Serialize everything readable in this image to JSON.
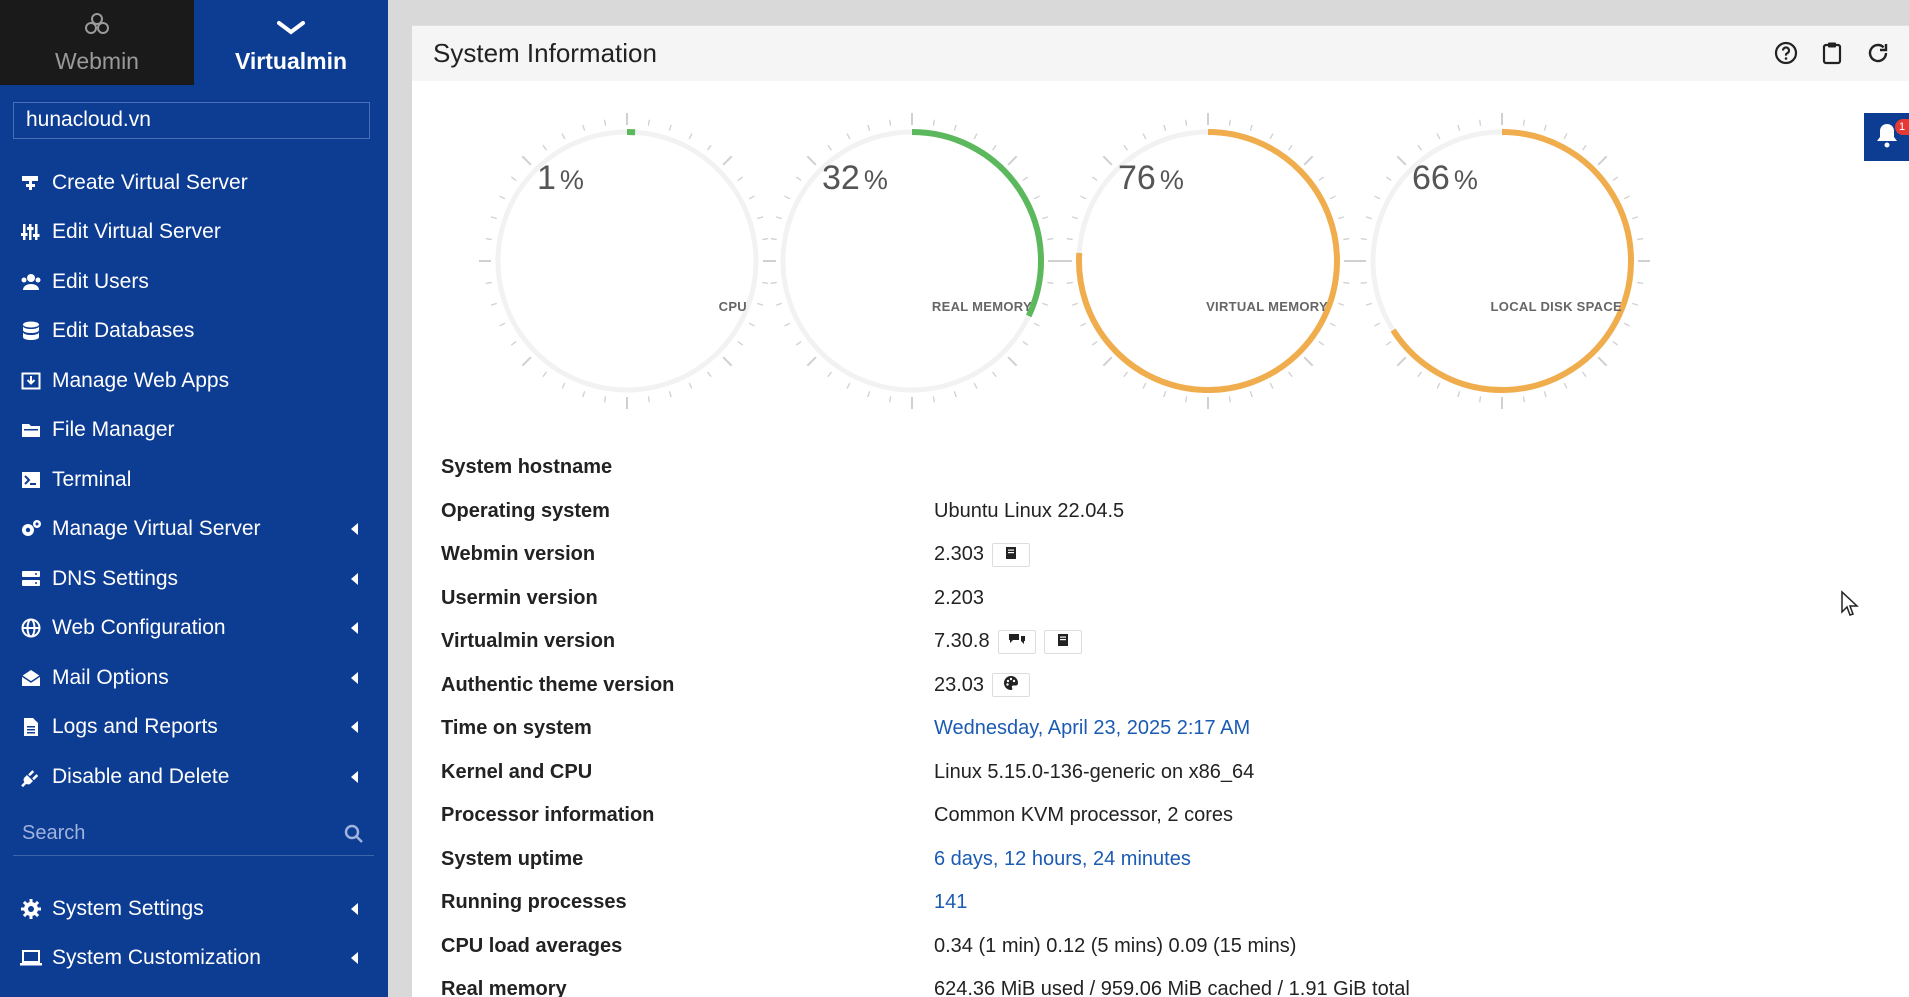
{
  "brand": {
    "webmin_label": "Webmin",
    "virtualmin_label": "Virtualmin"
  },
  "domain": {
    "value": "hunacloud.vn"
  },
  "menu": [
    {
      "label": "Create Virtual Server",
      "icon": "add-server-icon",
      "caret": false
    },
    {
      "label": "Edit Virtual Server",
      "icon": "sliders-icon",
      "caret": false
    },
    {
      "label": "Edit Users",
      "icon": "users-icon",
      "caret": false
    },
    {
      "label": "Edit Databases",
      "icon": "database-icon",
      "caret": false
    },
    {
      "label": "Manage Web Apps",
      "icon": "download-icon",
      "caret": false
    },
    {
      "label": "File Manager",
      "icon": "folder-icon",
      "caret": false
    },
    {
      "label": "Terminal",
      "icon": "terminal-icon",
      "caret": false
    },
    {
      "label": "Manage Virtual Server",
      "icon": "gears-icon",
      "caret": true
    },
    {
      "label": "DNS Settings",
      "icon": "server-icon",
      "caret": true
    },
    {
      "label": "Web Configuration",
      "icon": "globe-icon",
      "caret": true
    },
    {
      "label": "Mail Options",
      "icon": "envelope-open-icon",
      "caret": true
    },
    {
      "label": "Logs and Reports",
      "icon": "file-text-icon",
      "caret": true
    },
    {
      "label": "Disable and Delete",
      "icon": "plug-icon",
      "caret": true
    }
  ],
  "search": {
    "placeholder": "Search"
  },
  "menu2": [
    {
      "label": "System Settings",
      "icon": "gear-icon",
      "caret": true
    },
    {
      "label": "System Customization",
      "icon": "laptop-icon",
      "caret": true
    }
  ],
  "panel": {
    "title": "System Information",
    "header_icons": [
      "help-icon",
      "clipboard-icon",
      "refresh-icon"
    ]
  },
  "notification": {
    "count": "1"
  },
  "gauges": [
    {
      "value": "1",
      "unit": "%",
      "label": "CPU",
      "fraction": 0.01,
      "color": "#5cb85c"
    },
    {
      "value": "32",
      "unit": "%",
      "label": "REAL MEMORY",
      "fraction": 0.32,
      "color": "#5cb85c"
    },
    {
      "value": "76",
      "unit": "%",
      "label": "VIRTUAL MEMORY",
      "fraction": 0.76,
      "color": "#f0ad4e"
    },
    {
      "value": "66",
      "unit": "%",
      "label": "LOCAL DISK SPACE",
      "fraction": 0.66,
      "color": "#f0ad4e"
    }
  ],
  "info": [
    {
      "label": "System hostname",
      "value": "",
      "link": false,
      "buttons": []
    },
    {
      "label": "Operating system",
      "value": "Ubuntu Linux 22.04.5",
      "link": false,
      "buttons": []
    },
    {
      "label": "Webmin version",
      "value": "2.303",
      "link": false,
      "buttons": [
        "book-icon"
      ]
    },
    {
      "label": "Usermin version",
      "value": "2.203",
      "link": false,
      "buttons": []
    },
    {
      "label": "Virtualmin version",
      "value": "7.30.8",
      "link": false,
      "buttons": [
        "comments-icon",
        "book-icon"
      ]
    },
    {
      "label": "Authentic theme version",
      "value": "23.03",
      "link": false,
      "buttons": [
        "palette-icon"
      ]
    },
    {
      "label": "Time on system",
      "value": "Wednesday, April 23, 2025 2:17 AM",
      "link": true,
      "buttons": []
    },
    {
      "label": "Kernel and CPU",
      "value": "Linux 5.15.0-136-generic on x86_64",
      "link": false,
      "buttons": []
    },
    {
      "label": "Processor information",
      "value": "Common KVM processor, 2 cores",
      "link": false,
      "buttons": []
    },
    {
      "label": "System uptime",
      "value": "6 days, 12 hours, 24 minutes",
      "link": true,
      "buttons": []
    },
    {
      "label": "Running processes",
      "value": "141",
      "link": true,
      "buttons": []
    },
    {
      "label": "CPU load averages",
      "value": "0.34 (1 min) 0.12 (5 mins) 0.09 (15 mins)",
      "link": false,
      "buttons": []
    },
    {
      "label": "Real memory",
      "value": "624.36 MiB used / 959.06 MiB cached / 1.91 GiB total",
      "link": false,
      "buttons": []
    }
  ]
}
